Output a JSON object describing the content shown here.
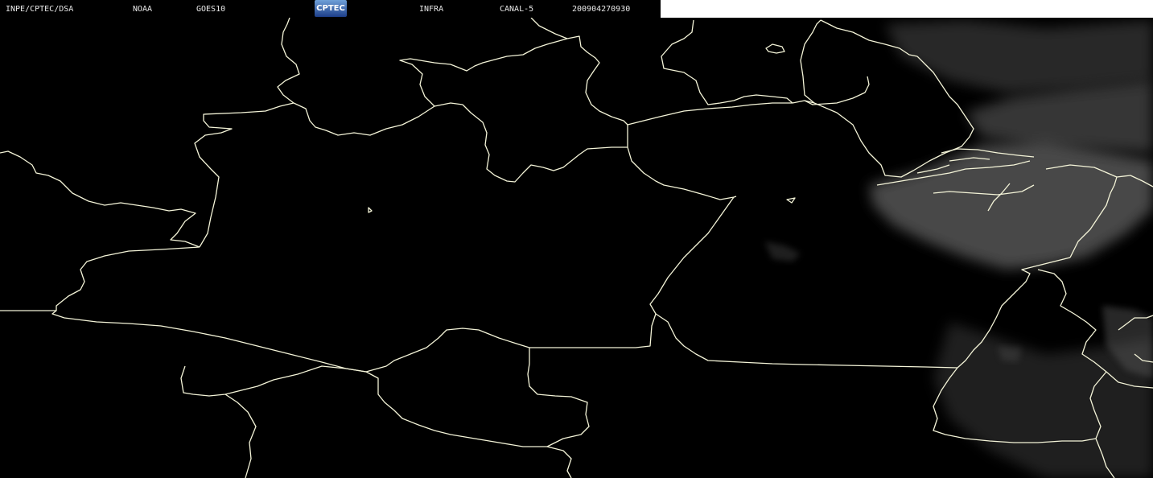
{
  "header": {
    "agency": "INPE/CPTEC/DSA",
    "noaa": "NOAA",
    "satellite": "GOES10",
    "logo_text": "CPTEC",
    "product": "INFRA",
    "channel": "CANAL-5",
    "timestamp": "200904270930"
  },
  "colors": {
    "background": "#000000",
    "borders": "#f4f4d8",
    "clouds": "#6a6a6a",
    "header_text": "#e8e8e8"
  }
}
